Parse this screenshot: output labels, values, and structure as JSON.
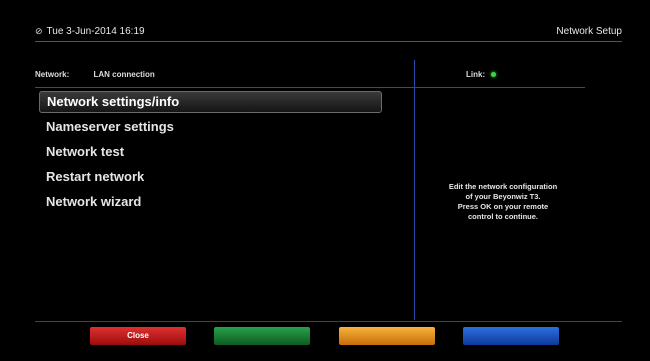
{
  "header": {
    "datetime": "Tue  3-Jun-2014 16:19",
    "title": "Network Setup"
  },
  "status": {
    "network_label": "Network:",
    "network_value": "LAN connection",
    "link_label": "Link:",
    "link_color": "#3fd43f"
  },
  "menu": {
    "items": [
      {
        "label": "Network settings/info"
      },
      {
        "label": "Nameserver settings"
      },
      {
        "label": "Network test"
      },
      {
        "label": "Restart network"
      },
      {
        "label": "Network wizard"
      }
    ]
  },
  "help": {
    "lines": [
      "Edit the network configuration",
      "of your Beyonwiz T3.",
      "Press OK on your remote",
      "control to continue."
    ]
  },
  "buttons": {
    "red_label": "Close",
    "colors": {
      "red": "#c01818",
      "green": "#1c7a36",
      "yellow": "#e89020",
      "blue": "#1e56c0"
    }
  }
}
